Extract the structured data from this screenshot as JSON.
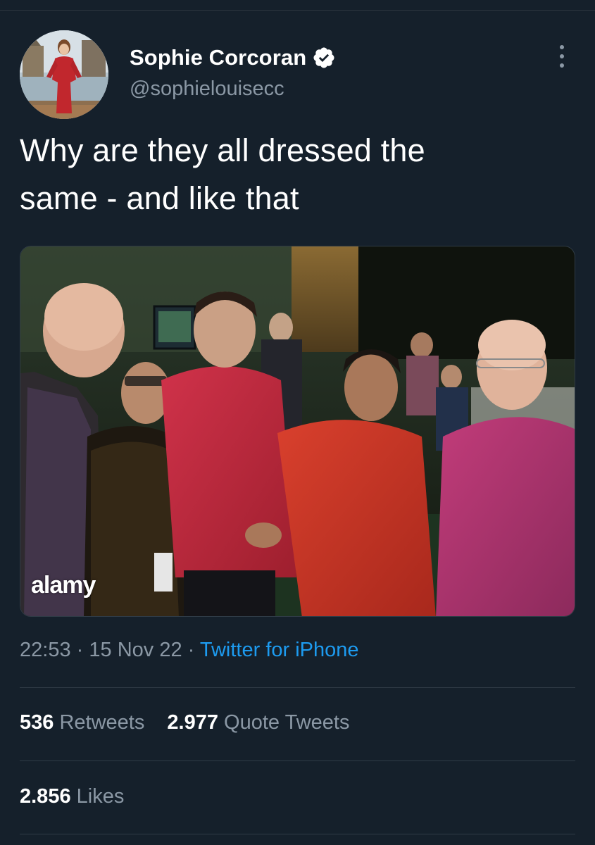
{
  "tweet": {
    "author": {
      "display_name": "Sophie Corcoran",
      "handle": "@sophielouisecc",
      "verified": true
    },
    "text_line_1": "Why are they all dressed the",
    "text_line_2": "same - and like that",
    "media": {
      "watermark": "alamy"
    },
    "meta": {
      "time": "22:53",
      "separator": "·",
      "date": "15 Nov 22",
      "source": "Twitter for iPhone"
    },
    "stats": {
      "retweets_count": "536",
      "retweets_label": "Retweets",
      "quotes_count": "2.977",
      "quotes_label": "Quote Tweets",
      "likes_count": "2.856",
      "likes_label": "Likes"
    }
  },
  "icons": {
    "verified": "verified-badge-icon",
    "more": "more-options-icon"
  },
  "colors": {
    "background": "#15202b",
    "text_primary": "#ffffff",
    "text_secondary": "#8b98a5",
    "link": "#1d9bf0",
    "divider": "#2f3b46"
  }
}
